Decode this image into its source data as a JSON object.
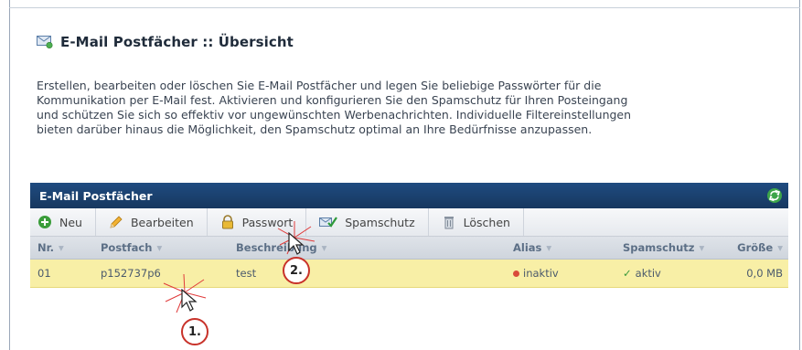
{
  "header": {
    "title": "E-Mail Postfächer :: Übersicht",
    "icon": "mailbox-icon"
  },
  "description": {
    "lines": [
      "Erstellen, bearbeiten oder löschen Sie E-Mail Postfächer und legen Sie beliebige Passwörter für die",
      "Kommunikation per E-Mail fest. Aktivieren und konfigurieren Sie den Spamschutz für Ihren Posteingang",
      "und schützen Sie sich so effektiv vor ungewünschten Werbenachrichten. Individuelle Filtereinstellungen",
      "bieten darüber hinaus die Möglichkeit, den Spamschutz optimal an Ihre Bedürfnisse anzupassen."
    ]
  },
  "panel": {
    "title": "E-Mail Postfächer",
    "toolbar": {
      "new_label": "Neu",
      "edit_label": "Bearbeiten",
      "password_label": "Passwort",
      "spam_label": "Spamschutz",
      "delete_label": "Löschen"
    },
    "columns": {
      "nr": "Nr.",
      "postfach": "Postfach",
      "beschreibung": "Beschreibung",
      "alias": "Alias",
      "spamschutz": "Spamschutz",
      "groesse": "Größe"
    },
    "rows": [
      {
        "nr": "01",
        "postfach": "p152737p6",
        "beschreibung": "test",
        "alias": "inaktiv",
        "spamschutz": "aktiv",
        "groesse": "0,0 MB"
      }
    ]
  },
  "callouts": {
    "one": "1.",
    "two": "2."
  },
  "colors": {
    "panel_header": "#1f4b80",
    "selected_row": "#f8efa6",
    "callout_ring": "#c8322a",
    "alias_inactive": "#d94a3a",
    "spam_active": "#3c9b3c"
  }
}
